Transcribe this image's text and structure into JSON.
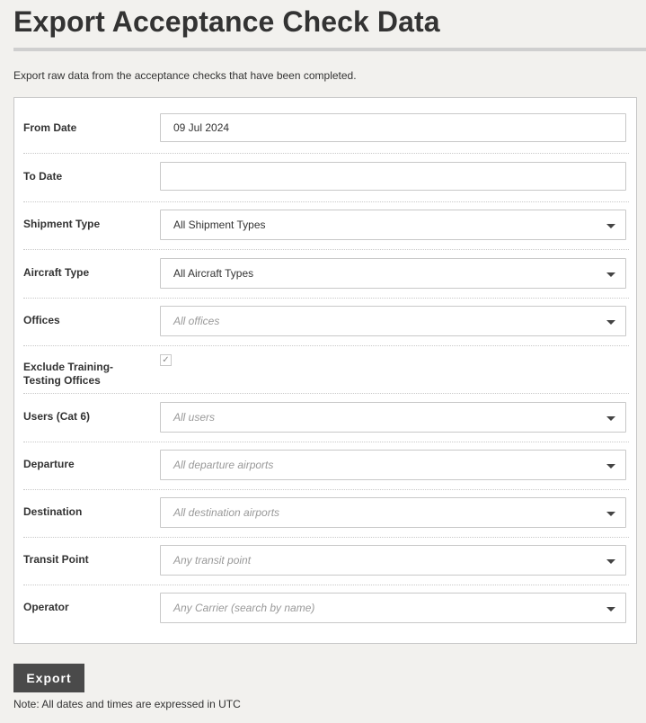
{
  "page": {
    "title": "Export Acceptance Check Data",
    "intro": "Export raw data from the acceptance checks that have been completed.",
    "note": "Note: All dates and times are expressed in UTC"
  },
  "form": {
    "from_date": {
      "label": "From Date",
      "value": "09 Jul 2024"
    },
    "to_date": {
      "label": "To Date",
      "value": ""
    },
    "shipment_type": {
      "label": "Shipment Type",
      "value": "All Shipment Types"
    },
    "aircraft_type": {
      "label": "Aircraft Type",
      "value": "All Aircraft Types"
    },
    "offices": {
      "label": "Offices",
      "placeholder": "All offices"
    },
    "exclude_training": {
      "label_line1": "Exclude Training-",
      "label_line2": "Testing Offices",
      "checked": true,
      "check_glyph": "✓"
    },
    "users": {
      "label": "Users (Cat 6)",
      "placeholder": "All users"
    },
    "departure": {
      "label": "Departure",
      "placeholder": "All departure airports"
    },
    "destination": {
      "label": "Destination",
      "placeholder": "All destination airports"
    },
    "transit_point": {
      "label": "Transit Point",
      "placeholder": "Any transit point"
    },
    "operator": {
      "label": "Operator",
      "placeholder": "Any Carrier (search by name)"
    }
  },
  "actions": {
    "export_label": "Export"
  },
  "icons": {
    "dropdown": "chevron-down-icon",
    "checkbox": "checkmark-icon"
  }
}
